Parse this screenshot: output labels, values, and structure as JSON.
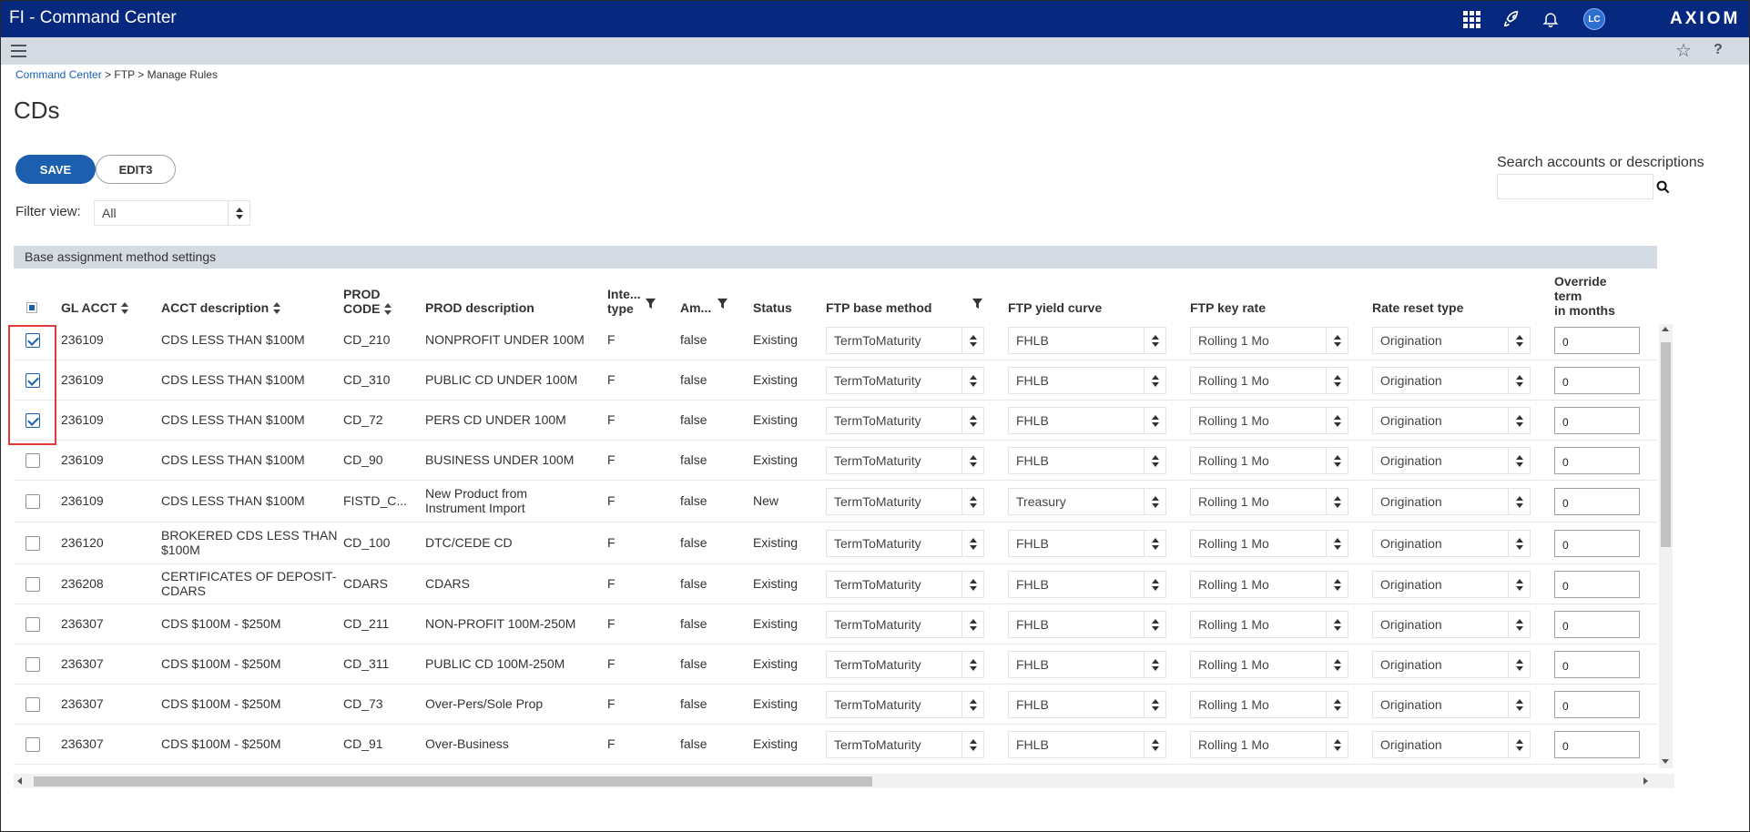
{
  "app": {
    "title": "FI - Command Center",
    "logo": "AXIOM",
    "avatar_initials": "LC",
    "accent_color": "#06287e"
  },
  "breadcrumb": {
    "items": [
      "Command Center",
      "FTP",
      "Manage Rules"
    ],
    "separator": ">"
  },
  "page": {
    "title": "CDs"
  },
  "toolbar": {
    "save_label": "SAVE",
    "edit_label": "EDIT3"
  },
  "search": {
    "label": "Search accounts or descriptions",
    "value": ""
  },
  "filter": {
    "label": "Filter view:",
    "value": "All"
  },
  "section": {
    "title": "Base assignment method settings"
  },
  "table": {
    "headers": {
      "gl_acct": "GL ACCT",
      "acct_desc": "ACCT description",
      "prod_code_1": "PROD",
      "prod_code_2": "CODE",
      "prod_desc": "PROD description",
      "int_type_1": "Inte...",
      "int_type_2": "type",
      "am": "Am...",
      "status": "Status",
      "ftp_base": "FTP base method",
      "ftp_yield": "FTP yield curve",
      "ftp_key": "FTP key rate",
      "rate_reset": "Rate reset type",
      "override_1": "Override",
      "override_2": "term",
      "override_3": "in months"
    },
    "rows": [
      {
        "checked": true,
        "gl": "236109",
        "acct": "CDS LESS THAN $100M",
        "acct2": "",
        "code": "CD_210",
        "desc": "NONPROFIT UNDER 100M",
        "desc2": "",
        "type": "F",
        "am": "false",
        "status": "Existing",
        "base": "TermToMaturity",
        "curve": "FHLB",
        "key": "Rolling 1 Mo",
        "reset": "Origination",
        "override": "0"
      },
      {
        "checked": true,
        "gl": "236109",
        "acct": "CDS LESS THAN $100M",
        "acct2": "",
        "code": "CD_310",
        "desc": "PUBLIC CD UNDER 100M",
        "desc2": "",
        "type": "F",
        "am": "false",
        "status": "Existing",
        "base": "TermToMaturity",
        "curve": "FHLB",
        "key": "Rolling 1 Mo",
        "reset": "Origination",
        "override": "0"
      },
      {
        "checked": true,
        "gl": "236109",
        "acct": "CDS LESS THAN $100M",
        "acct2": "",
        "code": "CD_72",
        "desc": "PERS CD UNDER 100M",
        "desc2": "",
        "type": "F",
        "am": "false",
        "status": "Existing",
        "base": "TermToMaturity",
        "curve": "FHLB",
        "key": "Rolling 1 Mo",
        "reset": "Origination",
        "override": "0"
      },
      {
        "checked": false,
        "gl": "236109",
        "acct": "CDS LESS THAN $100M",
        "acct2": "",
        "code": "CD_90",
        "desc": "BUSINESS UNDER 100M",
        "desc2": "",
        "type": "F",
        "am": "false",
        "status": "Existing",
        "base": "TermToMaturity",
        "curve": "FHLB",
        "key": "Rolling 1 Mo",
        "reset": "Origination",
        "override": "0"
      },
      {
        "checked": false,
        "gl": "236109",
        "acct": "CDS LESS THAN $100M",
        "acct2": "",
        "code": "FISTD_C...",
        "desc": "New Product from",
        "desc2": "Instrument Import",
        "type": "F",
        "am": "false",
        "status": "New",
        "base": "TermToMaturity",
        "curve": "Treasury",
        "key": "Rolling 1 Mo",
        "reset": "Origination",
        "override": "0"
      },
      {
        "checked": false,
        "gl": "236120",
        "acct": "BROKERED CDS LESS THAN",
        "acct2": "$100M",
        "code": "CD_100",
        "desc": "DTC/CEDE CD",
        "desc2": "",
        "type": "F",
        "am": "false",
        "status": "Existing",
        "base": "TermToMaturity",
        "curve": "FHLB",
        "key": "Rolling 1 Mo",
        "reset": "Origination",
        "override": "0"
      },
      {
        "checked": false,
        "gl": "236208",
        "acct": "CERTIFICATES OF DEPOSIT-",
        "acct2": "CDARS",
        "code": "CDARS",
        "desc": "CDARS",
        "desc2": "",
        "type": "F",
        "am": "false",
        "status": "Existing",
        "base": "TermToMaturity",
        "curve": "FHLB",
        "key": "Rolling 1 Mo",
        "reset": "Origination",
        "override": "0"
      },
      {
        "checked": false,
        "gl": "236307",
        "acct": "CDS $100M - $250M",
        "acct2": "",
        "code": "CD_211",
        "desc": "NON-PROFIT 100M-250M",
        "desc2": "",
        "type": "F",
        "am": "false",
        "status": "Existing",
        "base": "TermToMaturity",
        "curve": "FHLB",
        "key": "Rolling 1 Mo",
        "reset": "Origination",
        "override": "0"
      },
      {
        "checked": false,
        "gl": "236307",
        "acct": "CDS $100M - $250M",
        "acct2": "",
        "code": "CD_311",
        "desc": "PUBLIC CD 100M-250M",
        "desc2": "",
        "type": "F",
        "am": "false",
        "status": "Existing",
        "base": "TermToMaturity",
        "curve": "FHLB",
        "key": "Rolling 1 Mo",
        "reset": "Origination",
        "override": "0"
      },
      {
        "checked": false,
        "gl": "236307",
        "acct": "CDS $100M - $250M",
        "acct2": "",
        "code": "CD_73",
        "desc": "Over-Pers/Sole Prop",
        "desc2": "",
        "type": "F",
        "am": "false",
        "status": "Existing",
        "base": "TermToMaturity",
        "curve": "FHLB",
        "key": "Rolling 1 Mo",
        "reset": "Origination",
        "override": "0"
      },
      {
        "checked": false,
        "gl": "236307",
        "acct": "CDS $100M - $250M",
        "acct2": "",
        "code": "CD_91",
        "desc": "Over-Business",
        "desc2": "",
        "type": "F",
        "am": "false",
        "status": "Existing",
        "base": "TermToMaturity",
        "curve": "FHLB",
        "key": "Rolling 1 Mo",
        "reset": "Origination",
        "override": "0"
      }
    ]
  }
}
